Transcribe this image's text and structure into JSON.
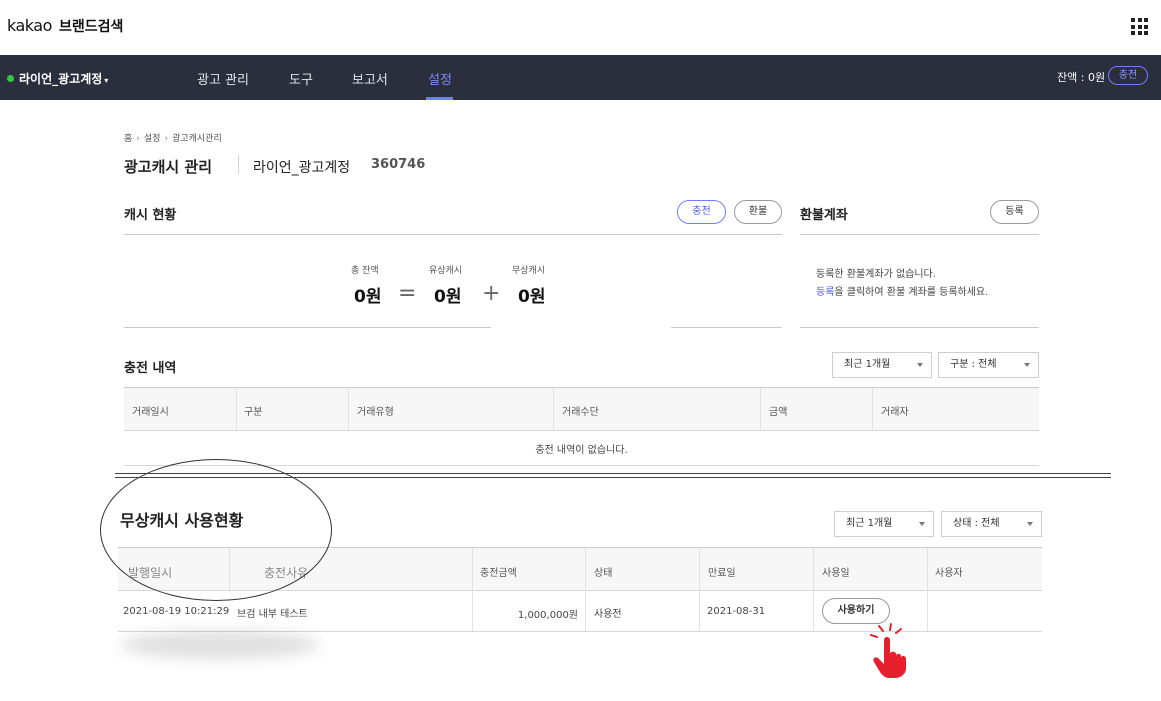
{
  "header": {
    "logo_kakao": "kakao",
    "logo_brand": "브랜드검색"
  },
  "nav": {
    "account": "라이언_광고계정",
    "tabs": [
      "광고 관리",
      "도구",
      "보고서",
      "설정"
    ],
    "active_tab": "설정",
    "balance": "잔액 : 0원",
    "charge": "충전"
  },
  "breadcrumb": [
    "홈",
    "설정",
    "광고캐시관리"
  ],
  "page": {
    "title": "광고캐시 관리",
    "account_name": "라이언_광고계정",
    "account_id": "360746"
  },
  "cash_status": {
    "title": "캐시 현황",
    "charge_button": "충전",
    "refund_button": "환불",
    "total_label": "총 잔액",
    "total_value": "0원",
    "paid_label": "유상캐시",
    "paid_value": "0원",
    "free_label": "무상캐시",
    "free_value": "0원",
    "op_equals": "=",
    "op_plus": "+"
  },
  "refund_account": {
    "title": "환불계좌",
    "register_button": "등록",
    "message_line1": "등록한 환불계좌가 없습니다.",
    "link_text": "등록",
    "message_line2_rest": "을 클릭하여 환불 계좌를 등록하세요."
  },
  "charge_history": {
    "title": "충전 내역",
    "period_select": "최근 1개월",
    "type_select": "구분 : 전체",
    "columns": [
      "거래일시",
      "구분",
      "거래유형",
      "거래수단",
      "금액",
      "거래자"
    ],
    "empty_message": "충전 내역이 없습니다."
  },
  "free_cash": {
    "title": "무상캐시 사용현황",
    "period_select": "최근 1개월",
    "status_select": "상태 : 전체",
    "columns": [
      "발행일시",
      "충전사유",
      "충전금액",
      "상태",
      "만료일",
      "사용일",
      "사용자"
    ],
    "rows": [
      {
        "issued": "2021-08-19 10:21:29",
        "reason": "브검 내부 테스트",
        "amount": "1,000,000원",
        "status": "사용전",
        "expiry": "2021-08-31",
        "use_button": "사용하기"
      }
    ]
  },
  "colors": {
    "nav_bg": "#2b2e3d",
    "accent": "#6f7dff",
    "status_dot": "#35c840",
    "cursor_red": "#e8202e"
  },
  "icons": [
    "apps-grid-icon",
    "chevron-down-icon",
    "pointer-hand-icon"
  ]
}
